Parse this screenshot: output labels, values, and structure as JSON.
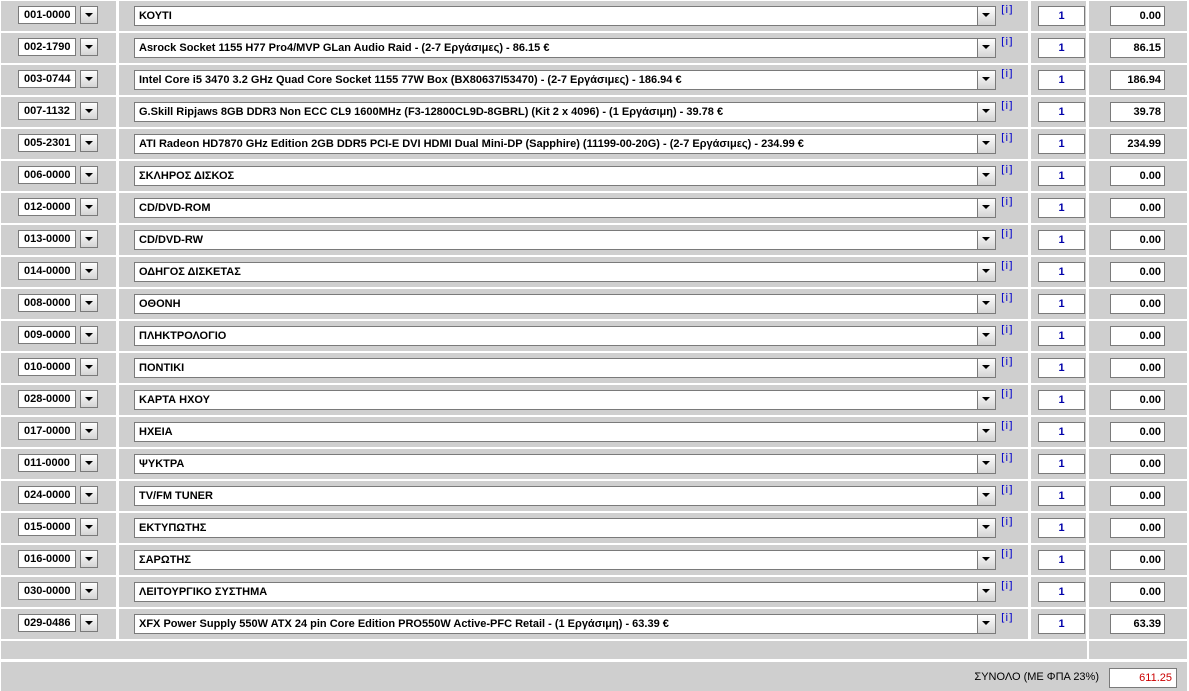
{
  "rows": [
    {
      "code": "001-0000",
      "item": "ΚΟΥΤΙ",
      "info": "[i]",
      "qty": "1",
      "price": "0.00"
    },
    {
      "code": "002-1790",
      "item": "Asrock Socket 1155 H77 Pro4/MVP GLan Audio Raid - (2-7 Εργάσιμες) - 86.15 €",
      "info": "[i]",
      "qty": "1",
      "price": "86.15"
    },
    {
      "code": "003-0744",
      "item": "Intel Core i5 3470 3.2 GHz Quad Core Socket 1155 77W Box (BX80637I53470) - (2-7 Εργάσιμες) - 186.94 €",
      "info": "[i]",
      "qty": "1",
      "price": "186.94"
    },
    {
      "code": "007-1132",
      "item": "G.Skill Ripjaws 8GB DDR3 Non ECC CL9 1600MHz (F3-12800CL9D-8GBRL) (Kit 2 x 4096) - (1 Εργάσιμη) - 39.78 €",
      "info": "[i]",
      "qty": "1",
      "price": "39.78"
    },
    {
      "code": "005-2301",
      "item": "ATI Radeon HD7870 GHz Edition 2GB DDR5 PCI-E DVI HDMI Dual Mini-DP (Sapphire) (11199-00-20G) - (2-7 Εργάσιμες) - 234.99 €",
      "info": "[i]",
      "qty": "1",
      "price": "234.99"
    },
    {
      "code": "006-0000",
      "item": "ΣΚΛΗΡΟΣ ΔΙΣΚΟΣ",
      "info": "[i]",
      "qty": "1",
      "price": "0.00"
    },
    {
      "code": "012-0000",
      "item": "CD/DVD-ROM",
      "info": "[i]",
      "qty": "1",
      "price": "0.00"
    },
    {
      "code": "013-0000",
      "item": "CD/DVD-RW",
      "info": "[i]",
      "qty": "1",
      "price": "0.00"
    },
    {
      "code": "014-0000",
      "item": "ΟΔΗΓΟΣ ΔΙΣΚΕΤΑΣ",
      "info": "[i]",
      "qty": "1",
      "price": "0.00"
    },
    {
      "code": "008-0000",
      "item": "ΟΘΟΝΗ",
      "info": "[i]",
      "qty": "1",
      "price": "0.00"
    },
    {
      "code": "009-0000",
      "item": "ΠΛΗΚΤΡΟΛΟΓΙΟ",
      "info": "[i]",
      "qty": "1",
      "price": "0.00"
    },
    {
      "code": "010-0000",
      "item": "ΠΟΝΤΙΚΙ",
      "info": "[i]",
      "qty": "1",
      "price": "0.00"
    },
    {
      "code": "028-0000",
      "item": "ΚΑΡΤΑ ΗΧΟΥ",
      "info": "[i]",
      "qty": "1",
      "price": "0.00"
    },
    {
      "code": "017-0000",
      "item": "ΗΧΕΙΑ",
      "info": "[i]",
      "qty": "1",
      "price": "0.00"
    },
    {
      "code": "011-0000",
      "item": "ΨΥΚΤΡΑ",
      "info": "[i]",
      "qty": "1",
      "price": "0.00"
    },
    {
      "code": "024-0000",
      "item": "TV/FM TUNER",
      "info": "[i]",
      "qty": "1",
      "price": "0.00"
    },
    {
      "code": "015-0000",
      "item": "ΕΚΤΥΠΩΤΗΣ",
      "info": "[i]",
      "qty": "1",
      "price": "0.00"
    },
    {
      "code": "016-0000",
      "item": "ΣΑΡΩΤΗΣ",
      "info": "[i]",
      "qty": "1",
      "price": "0.00"
    },
    {
      "code": "030-0000",
      "item": "ΛΕΙΤΟΥΡΓΙΚΟ ΣΥΣΤΗΜΑ",
      "info": "[i]",
      "qty": "1",
      "price": "0.00"
    },
    {
      "code": "029-0486",
      "item": "XFX Power Supply 550W ATX 24 pin Core Edition PRO550W Active-PFC Retail - (1 Εργάσιμη) - 63.39 €",
      "info": "[i]",
      "qty": "1",
      "price": "63.39"
    }
  ],
  "total": {
    "label": "ΣΥΝΟΛΟ (ΜΕ ΦΠΑ 23%)",
    "value": "611.25"
  },
  "colors": {
    "cell_bg": "#cfcfcf",
    "qty_text": "#0000aa",
    "info_link": "#0000cc",
    "total_value": "#cc0000"
  },
  "icons": {
    "dropdown": "chevron-down-icon",
    "info": "info-link"
  }
}
